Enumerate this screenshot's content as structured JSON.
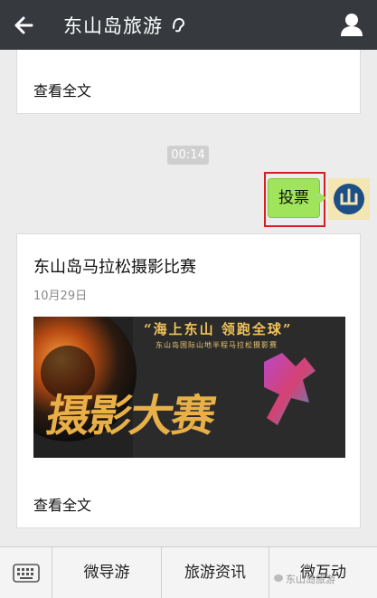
{
  "header": {
    "title": "东山岛旅游",
    "back_icon": "back-arrow-icon",
    "ear_icon": "ear-icon",
    "user_icon": "user-icon"
  },
  "messages": {
    "top_card": {
      "read_more": "查看全文"
    },
    "timestamp": "00:14",
    "vote_bubble": "投票",
    "article": {
      "title": "东山岛马拉松摄影比赛",
      "date": "10月29日",
      "image_slogan": "“海上东山 领跑全球”",
      "image_subtitle": "东山岛国际山地半程马拉松摄影赛",
      "image_big_text": "摄影大赛",
      "read_more": "查看全文"
    }
  },
  "menu": {
    "keyboard_icon": "keyboard-icon",
    "items": [
      "微导游",
      "旅游资讯",
      "微互动"
    ]
  },
  "watermark": "东山岛旅游",
  "colors": {
    "topbar": "#363a3e",
    "bubble": "#9fe45a",
    "highlight": "#d42020"
  }
}
